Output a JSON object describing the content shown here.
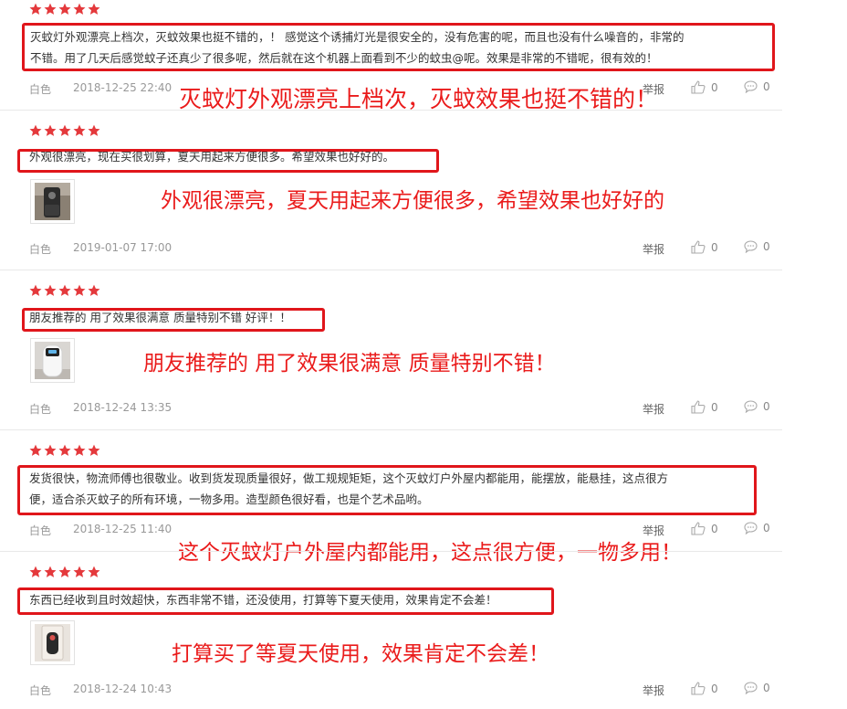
{
  "colors": {
    "accent_red": "#e0161b",
    "star": "#e4393c",
    "meta_gray": "#999999"
  },
  "icons": {
    "star": "star-icon",
    "like": "thumbs-up-icon",
    "reply": "comment-bubble-icon"
  },
  "reviews": [
    {
      "rating": 5,
      "text_lines": [
        "灭蚊灯外观漂亮上档次，灭蚊效果也挺不错的，！ 感觉这个诱捕灯光是很安全的，没有危害的呢，而且也没有什么噪音的，非常的",
        "不错。用了几天后感觉蚊子还真少了很多呢，然后就在这个机器上面看到不少的蚊虫@呢。效果是非常的不错呢，很有效的！"
      ],
      "variant": "白色",
      "date": "2018-12-25 22:40",
      "report": "举报",
      "likes": "0",
      "replies": "0",
      "annotation": "灭蚊灯外观漂亮上档次，灭蚊效果也挺不错的！"
    },
    {
      "rating": 5,
      "text_lines": [
        "外观很漂亮，现在买很划算，夏天用起来方便很多。希望效果也好好的。"
      ],
      "variant": "白色",
      "date": "2019-01-07 17:00",
      "report": "举报",
      "likes": "0",
      "replies": "0",
      "annotation": "外观很漂亮，夏天用起来方便很多，希望效果也好好的"
    },
    {
      "rating": 5,
      "text_lines": [
        "朋友推荐的 用了效果很满意 质量特别不错 好评！！"
      ],
      "variant": "白色",
      "date": "2018-12-24 13:35",
      "report": "举报",
      "likes": "0",
      "replies": "0",
      "annotation": "朋友推荐的 用了效果很满意 质量特别不错！"
    },
    {
      "rating": 5,
      "text_lines": [
        "发货很快，物流师傅也很敬业。收到货发现质量很好，做工规规矩矩，这个灭蚊灯户外屋内都能用，能摆放，能悬挂，这点很方",
        "便，适合杀灭蚊子的所有环境，一物多用。造型颜色很好看，也是个艺术品哟。"
      ],
      "variant": "白色",
      "date": "2018-12-25 11:40",
      "report": "举报",
      "likes": "0",
      "replies": "0",
      "annotation": "这个灭蚊灯户外屋内都能用，这点很方便，一物多用！"
    },
    {
      "rating": 5,
      "text_lines": [
        "东西已经收到且时效超快，东西非常不错，还没使用，打算等下夏天使用，效果肯定不会差！"
      ],
      "variant": "白色",
      "date": "2018-12-24 10:43",
      "report": "举报",
      "likes": "0",
      "replies": "0",
      "annotation": "打算买了等夏天使用，效果肯定不会差！"
    }
  ]
}
